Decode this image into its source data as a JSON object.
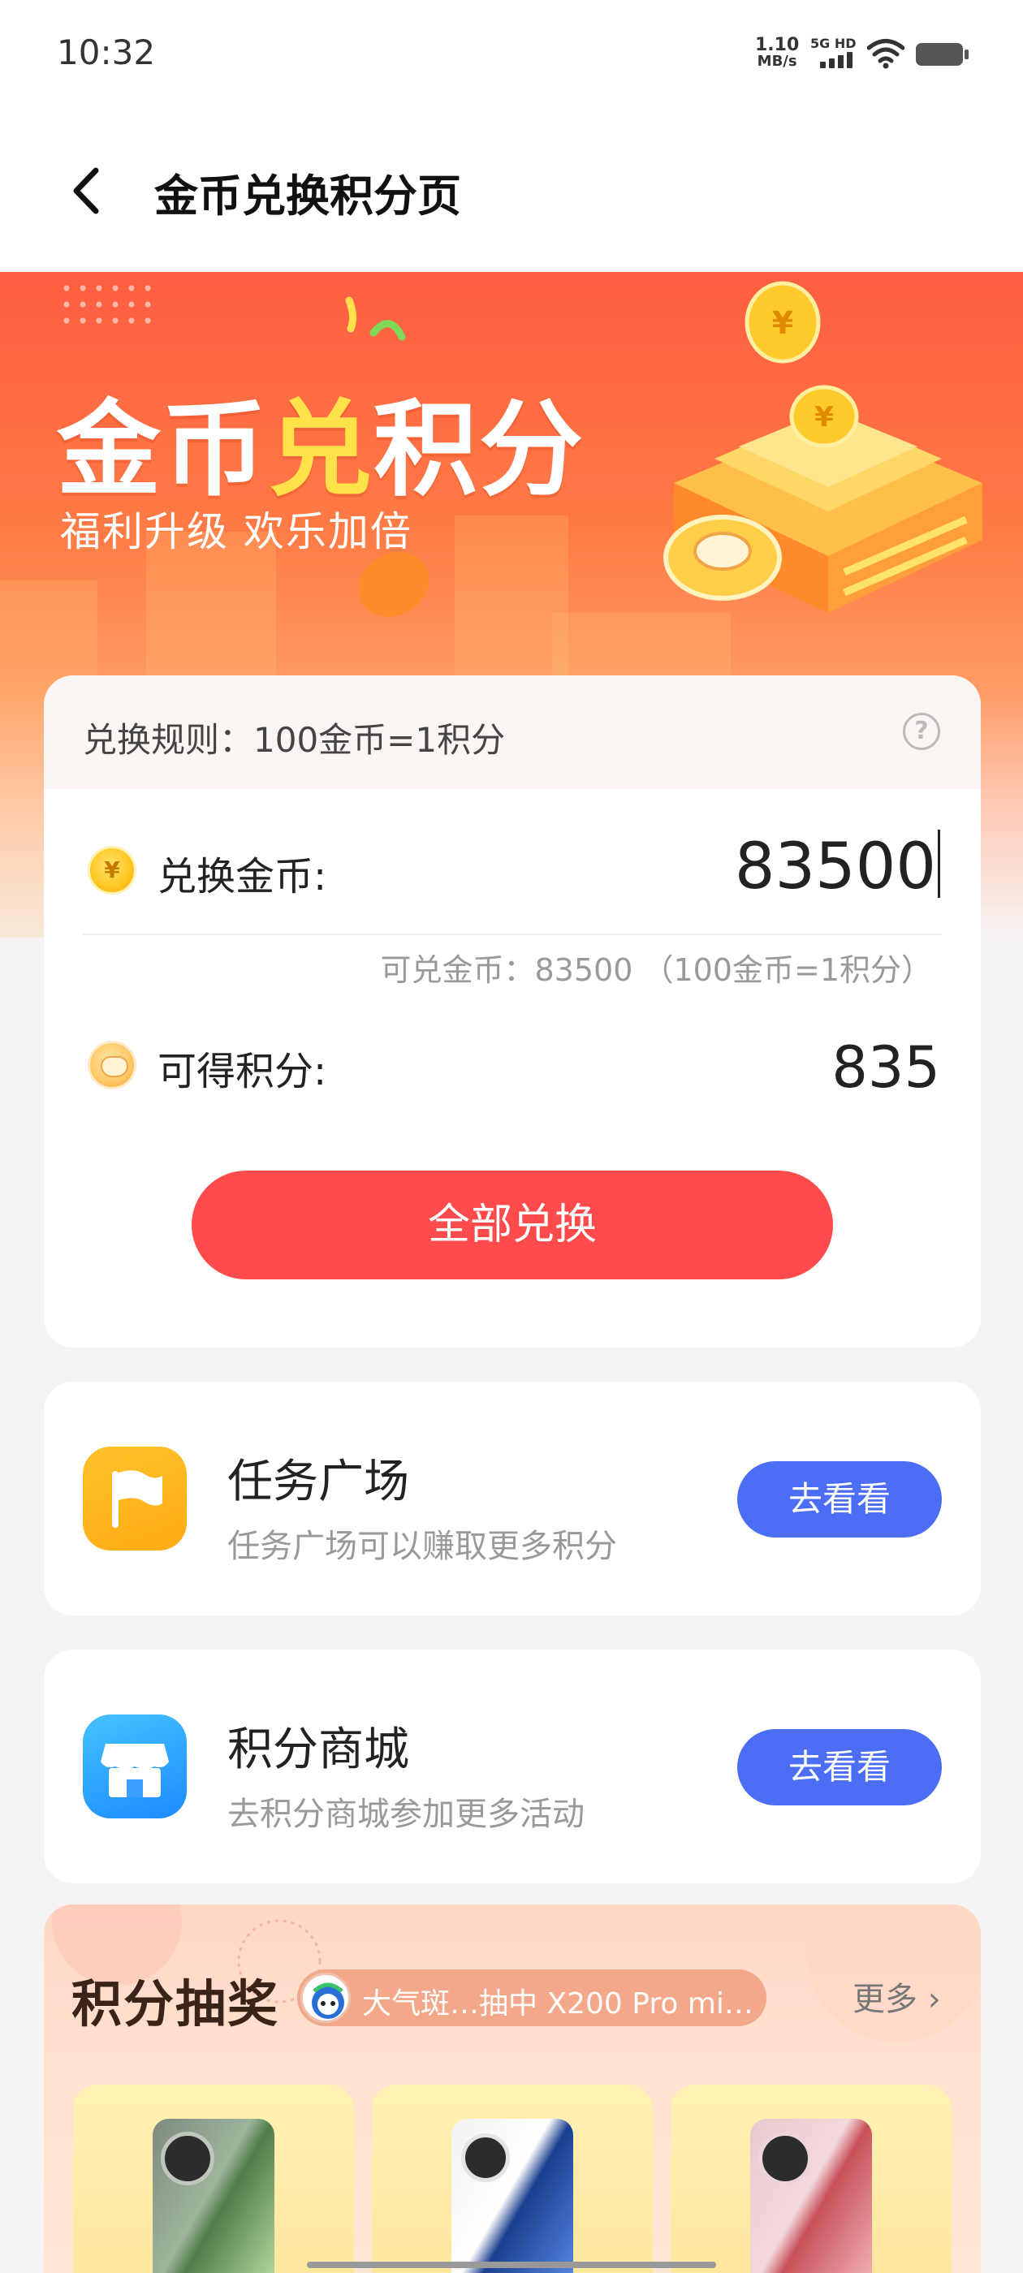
{
  "status_bar": {
    "time": "10:32",
    "net_speed": "1.10",
    "net_unit": "MB/s",
    "network": "5G HD"
  },
  "header": {
    "title": "金币兑换积分页"
  },
  "hero": {
    "title_part1": "金币",
    "title_highlight": "兑",
    "title_part2": "积分",
    "subtitle": "福利升级  欢乐加倍"
  },
  "exchange": {
    "rule": "兑换规则：100金币=1积分",
    "coin_label": "兑换金币:",
    "coin_value": "83500",
    "available_hint": "可兑金币：83500 （100金币=1积分）",
    "points_label": "可得积分:",
    "points_value": "835",
    "exchange_all_label": "全部兑换"
  },
  "tasks": [
    {
      "title": "任务广场",
      "desc": "任务广场可以赚取更多积分",
      "button": "去看看",
      "icon": "flag-icon"
    },
    {
      "title": "积分商城",
      "desc": "去积分商城参加更多活动",
      "button": "去看看",
      "icon": "shop-icon"
    }
  ],
  "lottery": {
    "title": "积分抽奖",
    "ticker": "大气斑…抽中 X200 Pro mi…",
    "more": "更多 ›"
  },
  "colors": {
    "primary_red": "#ff4b4b",
    "button_blue": "#4c6ef5",
    "hero_orange": "#ff6a42"
  }
}
